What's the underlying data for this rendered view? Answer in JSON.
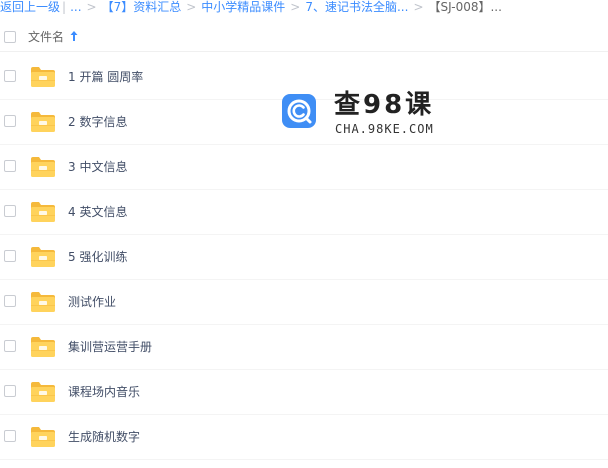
{
  "breadcrumb": {
    "back": "返回上一级",
    "ellipsis": "...",
    "items": [
      "【7】资料汇总",
      "中小学精品课件",
      "7、速记书法全脑...",
      "【SJ-008】..."
    ]
  },
  "header": {
    "column_name": "文件名",
    "sort_icon": "arrow-up-icon"
  },
  "files": [
    {
      "name": "1 开篇 圆周率",
      "icon": "folder-icon"
    },
    {
      "name": "2 数字信息",
      "icon": "folder-icon"
    },
    {
      "name": "3 中文信息",
      "icon": "folder-icon"
    },
    {
      "name": "4 英文信息",
      "icon": "folder-icon"
    },
    {
      "name": "5 强化训练",
      "icon": "folder-icon"
    },
    {
      "name": "测试作业",
      "icon": "folder-icon"
    },
    {
      "name": "集训营运营手册",
      "icon": "folder-icon"
    },
    {
      "name": "课程场内音乐",
      "icon": "folder-icon"
    },
    {
      "name": "生成随机数字",
      "icon": "folder-icon"
    }
  ],
  "watermark": {
    "title": "查98课",
    "url": "CHA.98KE.COM"
  },
  "colors": {
    "link": "#3b8cff",
    "folder": "#ffd35c",
    "folder_tab": "#f5b93b",
    "logo": "#3f8ef5"
  }
}
